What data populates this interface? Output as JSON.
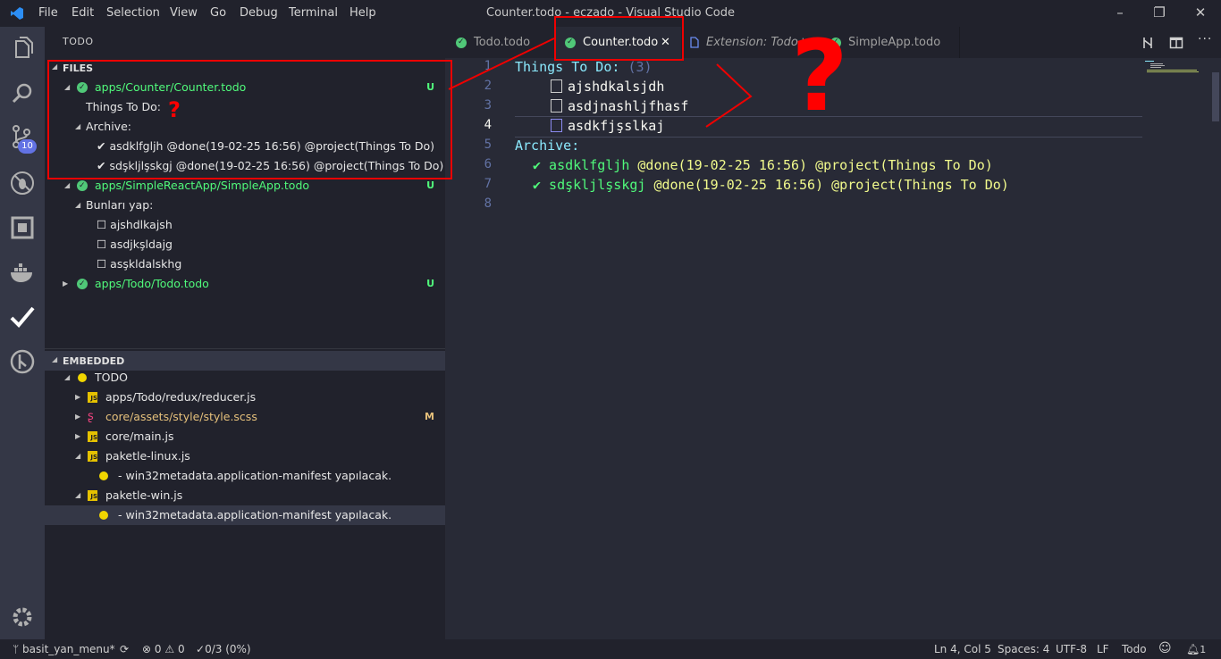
{
  "window": {
    "title": "Counter.todo - eczado - Visual Studio Code",
    "menu": [
      "File",
      "Edit",
      "Selection",
      "View",
      "Go",
      "Debug",
      "Terminal",
      "Help"
    ]
  },
  "activity_bar": {
    "icons": [
      "files-icon",
      "search-icon",
      "source-control-icon",
      "debug-icon",
      "extensions-icon",
      "docker-icon",
      "todo-check-icon",
      "git-graph-icon",
      "settings-gear-icon"
    ],
    "scm_badge": "10"
  },
  "sidebar": {
    "title": "TODO",
    "files_header": "FILES",
    "files": [
      {
        "name": "apps/Counter/Counter.todo",
        "badge": "U"
      },
      {
        "name": "Things To Do:"
      },
      {
        "name": "Archive:"
      },
      {
        "name": "✔ asdklfgljh @done(19-02-25 16:56) @project(Things To Do)"
      },
      {
        "name": "✔ sdşkljlşskgj @done(19-02-25 16:56) @project(Things To Do)"
      },
      {
        "name": "apps/SimpleReactApp/SimpleApp.todo",
        "badge": "U"
      },
      {
        "name": "Bunları yap:"
      },
      {
        "name": "☐ ajshdlkajsh"
      },
      {
        "name": "☐ asdjkşldajg"
      },
      {
        "name": "☐ asşkldalskhg"
      },
      {
        "name": "apps/Todo/Todo.todo",
        "badge": "U"
      }
    ],
    "embedded_header": "EMBEDDED",
    "embedded": [
      {
        "name": "TODO"
      },
      {
        "name": "apps/Todo/redux/reducer.js"
      },
      {
        "name": "core/assets/style/style.scss",
        "badge": "M"
      },
      {
        "name": "core/main.js"
      },
      {
        "name": "paketle-linux.js"
      },
      {
        "name": "- win32metadata.application-manifest yapılacak."
      },
      {
        "name": "paketle-win.js"
      },
      {
        "name": "- win32metadata.application-manifest yapılacak."
      }
    ]
  },
  "tabs": [
    {
      "label": "Todo.todo"
    },
    {
      "label": "Counter.todo",
      "active": true
    },
    {
      "label": "Extension: Todo+"
    },
    {
      "label": "SimpleApp.todo"
    }
  ],
  "editor": {
    "lines": [
      {
        "num": "1",
        "project": "Things To Do:",
        "count": "(3)"
      },
      {
        "num": "2",
        "text": "ajshdkalsjdh"
      },
      {
        "num": "3",
        "text": "asdjnashljfhasf"
      },
      {
        "num": "4",
        "text": "asdkfjşslkaj"
      },
      {
        "num": "5",
        "project": "Archive:"
      },
      {
        "num": "6",
        "done": "✔ asdklfgljh",
        "tags": "@done(19-02-25 16:56) @project(Things To Do)"
      },
      {
        "num": "7",
        "done": "✔ sdşkljlşskgj",
        "tags": "@done(19-02-25 16:56) @project(Things To Do)"
      },
      {
        "num": "8"
      }
    ]
  },
  "annotations": {
    "question": "?"
  },
  "status_bar": {
    "branch": "basit_yan_menu*",
    "errors": "0",
    "warnings": "0",
    "todo_progress": "0/3 (0%)",
    "position": "Ln 4, Col 5",
    "spaces": "Spaces: 4",
    "encoding": "UTF-8",
    "eol": "LF",
    "language": "Todo"
  },
  "colors": {
    "accent_green": "#50fa7b",
    "project_cyan": "#8be9fd",
    "done_yellow": "#f1fa8c",
    "annotation_red": "#ff0000"
  }
}
